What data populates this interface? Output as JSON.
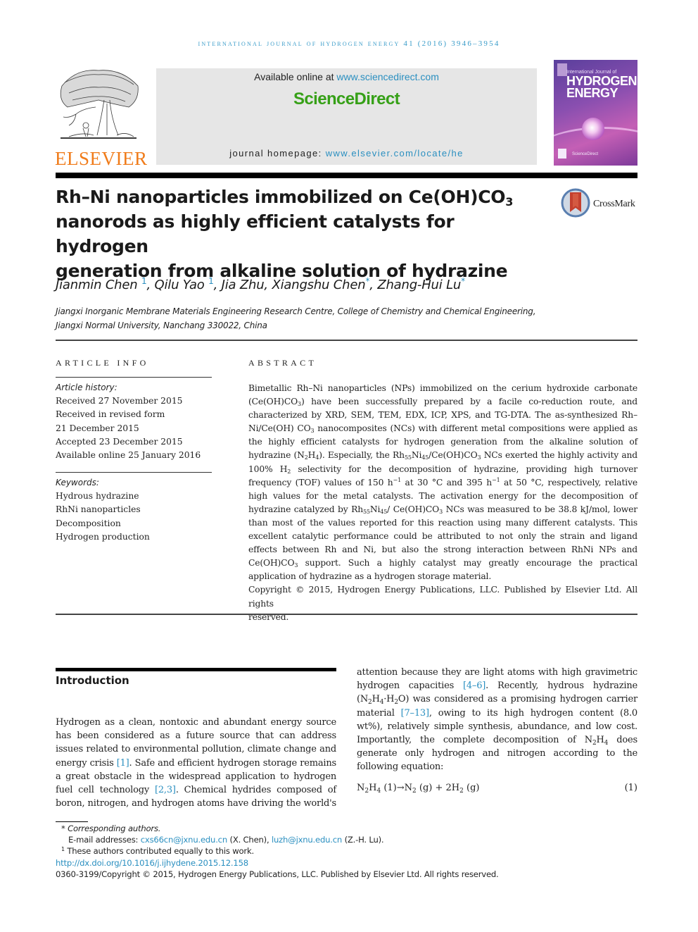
{
  "running_head": "International Journal of Hydrogen Energy 41 (2016) 3946–3954",
  "publisher": {
    "logo_word": "ELSEVIER",
    "brand_color": "#f07c1b"
  },
  "sciencedirect": {
    "available_prefix": "Available online at ",
    "available_url": "www.sciencedirect.com",
    "logo_text": "ScienceDirect",
    "logo_color": "#36a017",
    "homepage_prefix": "journal homepage: ",
    "homepage_url": "www.elsevier.com/locate/he"
  },
  "cover": {
    "small_line": "International Journal of",
    "big_line_1": "HYDROGEN",
    "big_line_2": "ENERGY",
    "bottom_text": "ScienceDirect"
  },
  "article": {
    "title_part_1": "Rh–Ni nanoparticles immobilized on Ce(OH)CO",
    "title_sub": "3",
    "title_part_2": "nanorods as highly efficient catalysts for hydrogen",
    "title_part_3": "generation from alkaline solution of hydrazine",
    "crossmark_label": "CrossMark",
    "authors": [
      {
        "name": "Jianmin Chen",
        "mark": "1"
      },
      {
        "name": "Qilu Yao",
        "mark": "1"
      },
      {
        "name": "Jia Zhu",
        "mark": ""
      },
      {
        "name": "Xiangshu Chen",
        "mark": "*"
      },
      {
        "name": "Zhang-Hui Lu",
        "mark": "*"
      }
    ],
    "affiliation_line_1": "Jiangxi Inorganic Membrane Materials Engineering Research Centre, College of Chemistry and Chemical Engineering,",
    "affiliation_line_2": "Jiangxi Normal University, Nanchang 330022, China"
  },
  "article_info": {
    "heading": "ARTICLE INFO",
    "history_label": "Article history:",
    "history": [
      "Received 27 November 2015",
      "Received in revised form",
      "21 December 2015",
      "Accepted 23 December 2015",
      "Available online 25 January 2016"
    ],
    "keywords_label": "Keywords:",
    "keywords": [
      "Hydrous hydrazine",
      "RhNi nanoparticles",
      "Decomposition",
      "Hydrogen production"
    ]
  },
  "abstract": {
    "heading": "ABSTRACT",
    "s1": "Bimetallic Rh–Ni nanoparticles (NPs) immobilized on the cerium hydroxide carbonate (Ce(OH)CO",
    "s2": ") have been successfully prepared by a facile co-reduction route, and characterized by XRD, SEM, TEM, EDX, ICP, XPS, and TG-DTA. The as-synthesized Rh–Ni/Ce(OH) CO",
    "s3": " nanocomposites (NCs) with different metal compositions were applied as the highly efficient catalysts for hydrogen generation from the alkaline solution of hydrazine (N",
    "s4": "H",
    "s5": "). Especially, the Rh",
    "s6": "Ni",
    "s7": "/Ce(OH)CO",
    "s8": " NCs exerted the highly activity and 100% H",
    "s9": " selectivity for the decomposition of hydrazine, providing high turnover frequency (TOF) values of 150 h",
    "s10": " at 30 °C and 395 h",
    "s11": " at 50 °C, respectively, relative high values for the metal catalysts. The activation energy for the decomposition of hydrazine catalyzed by Rh",
    "s12": "Ni",
    "s13": "/ Ce(OH)CO",
    "s14": " NCs was measured to be 38.8 kJ/mol, lower than most of the values reported for this reaction using many different catalysts. This excellent catalytic performance could be attributed to not only the strain and ligand effects between Rh and Ni, but also the strong interaction between RhNi NPs and Ce(OH)CO",
    "s15": " support. Such a highly catalyst may greatly encourage the practical application of hydrazine as a hydrogen storage material.",
    "sub_3": "3",
    "sub_2": "2",
    "sub_4": "4",
    "sub_55": "55",
    "sub_45": "45",
    "sup_m1": "−1",
    "copyright_main": "Copyright © 2015, Hydrogen Energy Publications, LLC. Published by Elsevier Ltd. All rights",
    "copyright_end": "reserved."
  },
  "introduction": {
    "heading": "Introduction",
    "left_1": "Hydrogen as a clean, nontoxic and abundant energy source has been considered as a future source that can address issues related to environmental pollution, climate change and energy crisis ",
    "ref_1": "[1]",
    "left_2": ". Safe and efficient hydrogen storage remains a great obstacle in the widespread application to hydrogen fuel cell technology ",
    "ref_2": "[2,3]",
    "left_3": ". Chemical hydrides composed of boron, nitrogen, and hydrogen atoms have driving the world's",
    "right_1": "attention because they are light atoms with high gravimetric hydrogen capacities ",
    "ref_3": "[4–6]",
    "right_2": ". Recently, hydrous hydrazine (N",
    "right_3": "H",
    "right_4": "·H",
    "right_5": "O) was considered as a promising hydrogen carrier material ",
    "ref_4": "[7–13]",
    "right_6": ", owing to its high hydrogen content (8.0 wt%), relatively simple synthesis, abundance, and low cost. Importantly, the complete decomposition of N",
    "right_7": "H",
    "right_8": " does generate only hydrogen and nitrogen according to the following equation:",
    "sub_2": "2",
    "sub_4": "4",
    "equation": {
      "a": "N",
      "b": "H",
      "c": " (1)→N",
      "d": " (g) + 2H",
      "e": " (g)",
      "number": "(1)"
    }
  },
  "footnotes": {
    "corresponding": "* Corresponding authors.",
    "email_label": "E-mail addresses: ",
    "email_1": "cxs66cn@jxnu.edu.cn",
    "email_1_owner": " (X. Chen), ",
    "email_2": "luzh@jxnu.edu.cn",
    "email_2_owner": " (Z.-H. Lu).",
    "equal_mark": "1",
    "equal_text": " These authors contributed equally to this work.",
    "doi": "http://dx.doi.org/10.1016/j.ijhydene.2015.12.158",
    "issn_copyright": "0360-3199/Copyright © 2015, Hydrogen Energy Publications, LLC. Published by Elsevier Ltd. All rights reserved."
  },
  "colors": {
    "link": "#2a8fc0",
    "running_head": "#3a9cc9",
    "header_box": "#e6e6e6"
  }
}
